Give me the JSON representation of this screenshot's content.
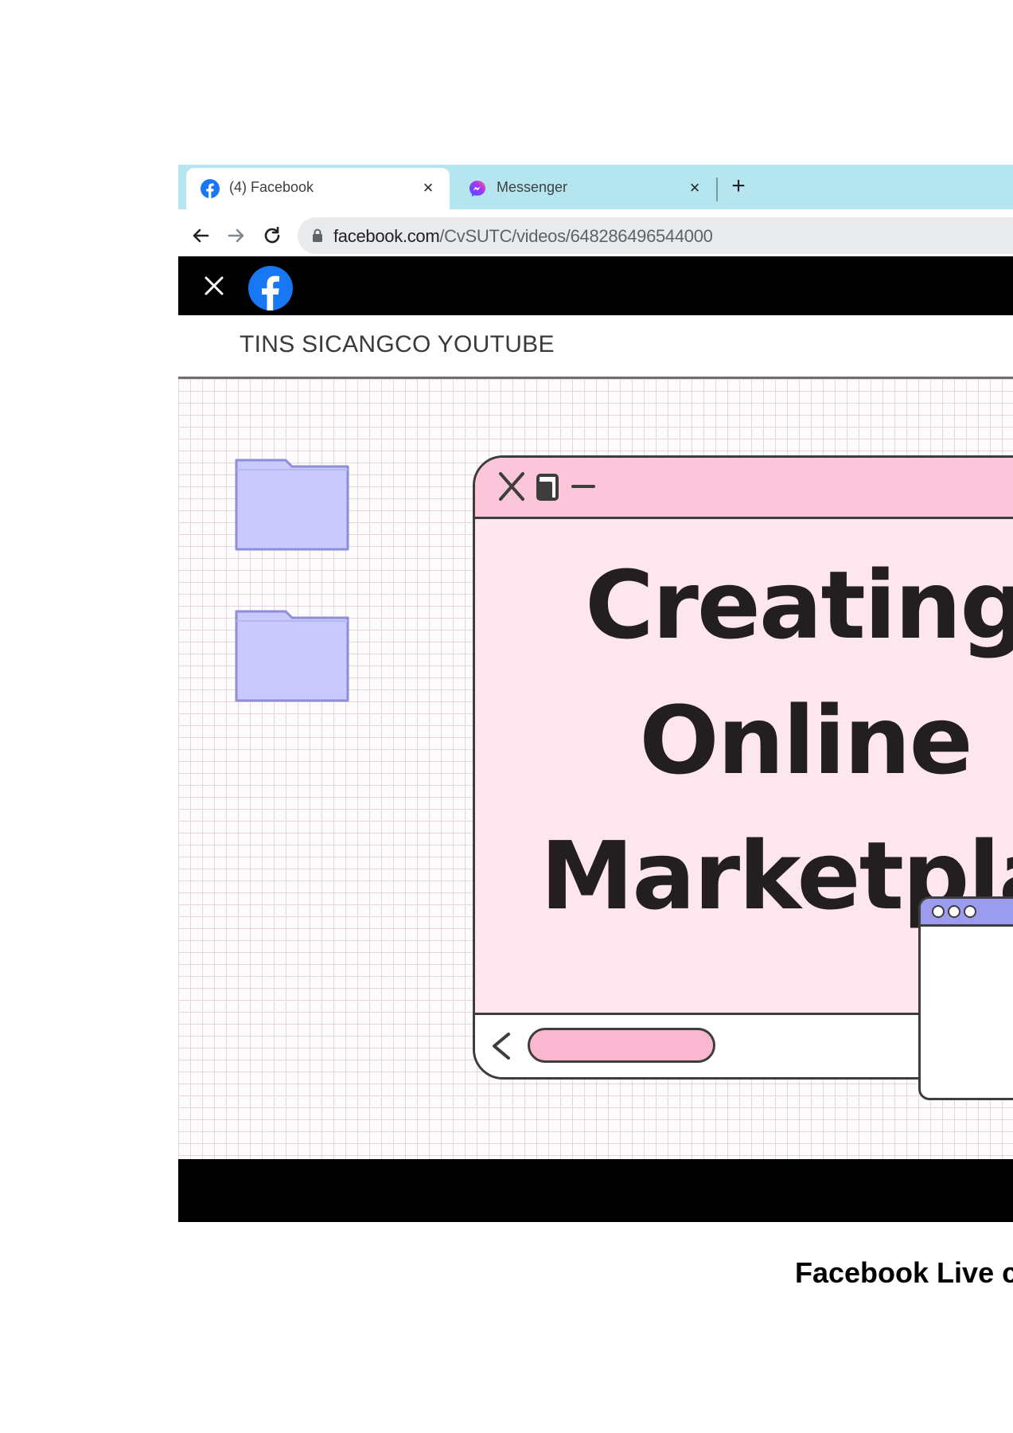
{
  "browser": {
    "tabs": [
      {
        "title": "(4) Facebook",
        "icon": "facebook-icon",
        "active": true,
        "close_label": "×"
      },
      {
        "title": "Messenger",
        "icon": "messenger-icon",
        "active": false,
        "close_label": "×"
      }
    ],
    "new_tab_label": "+",
    "address": {
      "domain": "facebook.com",
      "path": "/CvSUTC/videos/648286496544000"
    },
    "colors": {
      "tabstrip": "#b5e6ef",
      "omnibox": "#e9eaec"
    }
  },
  "viewer": {
    "close_icon": "close-icon",
    "logo_icon": "facebook-logo-icon"
  },
  "video": {
    "channel_name": "TINS SICANGCO YOUTUBE",
    "headline_lines": [
      "Creating",
      "Online",
      "Marketplac"
    ],
    "colors": {
      "window_pink": "#fde6ee",
      "titlebar_pink": "#fcc6da",
      "folder_lavender": "#c9c9fb",
      "mini_bar": "#9b9cef"
    }
  },
  "caption": "Facebook Live c"
}
